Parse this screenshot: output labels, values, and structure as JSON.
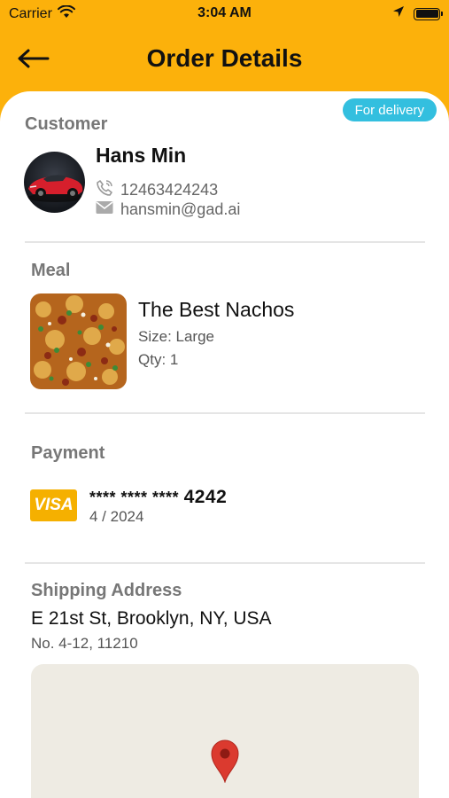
{
  "status_bar": {
    "carrier": "Carrier",
    "time": "3:04 AM",
    "icons": [
      "wifi-icon",
      "location-arrow-icon",
      "battery-icon"
    ]
  },
  "header": {
    "title": "Order Details",
    "back_icon": "arrow-left-icon",
    "background_color": "#FCB10B"
  },
  "order": {
    "badge": "For delivery",
    "badge_color": "#33BFDF"
  },
  "customer": {
    "section_title": "Customer",
    "name": "Hans Min",
    "phone": "12463424243",
    "email": "hansmin@gad.ai",
    "icons": [
      "phone-icon",
      "mail-icon"
    ]
  },
  "meal": {
    "section_title": "Meal",
    "name": "The Best Nachos",
    "size": "Size: Large",
    "qty": "Qty: 1"
  },
  "payment": {
    "section_title": "Payment",
    "card_brand": "VISA",
    "card_mask": "**** **** ****",
    "card_last4": "4242",
    "expiry": "4 / 2024"
  },
  "shipping": {
    "section_title": "Shipping Address",
    "line1": "E 21st St, Brooklyn, NY, USA",
    "line2": "No. 4-12, 11210",
    "map_icon": "map-pin-icon"
  }
}
